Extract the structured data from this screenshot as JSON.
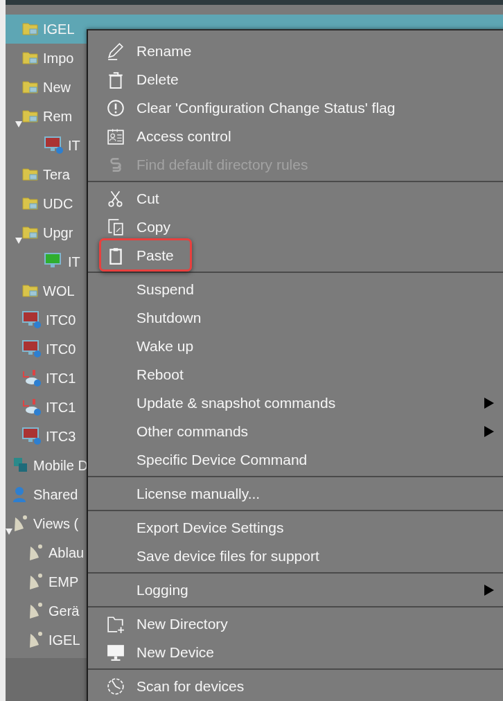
{
  "tree": {
    "device_nodes": [
      {
        "label": "IGEL",
        "kind": "folder",
        "selected": true
      },
      {
        "label": "Impo",
        "kind": "folder",
        "selected": false
      },
      {
        "label": "New",
        "kind": "folder",
        "selected": false
      },
      {
        "label": "Rem",
        "kind": "folder",
        "selected": false,
        "expanded": true,
        "children": [
          {
            "label": "IT",
            "kind": "device-offline",
            "selected": false
          }
        ]
      },
      {
        "label": "Tera",
        "kind": "folder",
        "selected": false
      },
      {
        "label": "UDC",
        "kind": "folder",
        "selected": false
      },
      {
        "label": "Upgr",
        "kind": "folder",
        "selected": false,
        "expanded": true,
        "children": [
          {
            "label": "IT",
            "kind": "device-online",
            "selected": false
          }
        ]
      },
      {
        "label": "WOL",
        "kind": "folder",
        "selected": false
      },
      {
        "label": "ITC0",
        "kind": "device-offline",
        "selected": false
      },
      {
        "label": "ITC0",
        "kind": "device-offline",
        "selected": false
      },
      {
        "label": "ITC1",
        "kind": "ud-device",
        "selected": false
      },
      {
        "label": "ITC1",
        "kind": "ud-device",
        "selected": false
      },
      {
        "label": "ITC3",
        "kind": "device-offline",
        "selected": false
      }
    ],
    "root_nodes": [
      {
        "label": "Mobile D",
        "kind": "mobile",
        "selected": false
      },
      {
        "label": "Shared",
        "kind": "user",
        "selected": false
      },
      {
        "label": "Views (",
        "kind": "view",
        "selected": false,
        "expanded": true,
        "children": [
          {
            "label": "Ablau",
            "kind": "view",
            "selected": false
          },
          {
            "label": "EMP",
            "kind": "view",
            "selected": false
          },
          {
            "label": "Gerä",
            "kind": "view",
            "selected": false
          },
          {
            "label": "IGEL",
            "kind": "view",
            "selected": false
          }
        ]
      }
    ]
  },
  "context_menu": {
    "sections": [
      {
        "items": [
          {
            "label": "Rename",
            "kind": "pencil",
            "disabled": false,
            "submenu": false,
            "highlighted": false
          },
          {
            "label": "Delete",
            "kind": "trash",
            "disabled": false,
            "submenu": false,
            "highlighted": false
          },
          {
            "label": "Clear 'Configuration Change Status' flag",
            "kind": "exclamation",
            "disabled": false,
            "submenu": false,
            "highlighted": false
          },
          {
            "label": "Access control",
            "kind": "id-card",
            "disabled": false,
            "submenu": false,
            "highlighted": false
          },
          {
            "label": "Find default directory rules",
            "kind": "section",
            "disabled": true,
            "submenu": false,
            "highlighted": false
          }
        ]
      },
      {
        "items": [
          {
            "label": "Cut",
            "kind": "scissors",
            "disabled": false,
            "submenu": false,
            "highlighted": false
          },
          {
            "label": "Copy",
            "kind": "copy",
            "disabled": false,
            "submenu": false,
            "highlighted": false
          },
          {
            "label": "Paste",
            "kind": "clipboard",
            "disabled": false,
            "submenu": false,
            "highlighted": true
          }
        ]
      },
      {
        "items": [
          {
            "label": "Suspend",
            "disabled": false,
            "submenu": false,
            "highlighted": false
          },
          {
            "label": "Shutdown",
            "disabled": false,
            "submenu": false,
            "highlighted": false
          },
          {
            "label": "Wake up",
            "disabled": false,
            "submenu": false,
            "highlighted": false
          },
          {
            "label": "Reboot",
            "disabled": false,
            "submenu": false,
            "highlighted": false
          },
          {
            "label": "Update & snapshot commands",
            "disabled": false,
            "submenu": true,
            "highlighted": false
          },
          {
            "label": "Other commands",
            "disabled": false,
            "submenu": true,
            "highlighted": false
          },
          {
            "label": "Specific Device Command",
            "disabled": false,
            "submenu": false,
            "highlighted": false
          }
        ]
      },
      {
        "items": [
          {
            "label": "License manually...",
            "disabled": false,
            "submenu": false,
            "highlighted": false
          }
        ]
      },
      {
        "items": [
          {
            "label": "Export Device Settings",
            "disabled": false,
            "submenu": false,
            "highlighted": false
          },
          {
            "label": "Save device files for support",
            "disabled": false,
            "submenu": false,
            "highlighted": false
          }
        ]
      },
      {
        "items": [
          {
            "label": "Logging",
            "disabled": false,
            "submenu": true,
            "highlighted": false
          }
        ]
      },
      {
        "items": [
          {
            "label": "New Directory",
            "kind": "folder-plus",
            "disabled": false,
            "submenu": false,
            "highlighted": false
          },
          {
            "label": "New Device",
            "kind": "monitor",
            "disabled": false,
            "submenu": false,
            "highlighted": false
          }
        ]
      },
      {
        "items": [
          {
            "label": "Scan for devices",
            "kind": "radar",
            "disabled": false,
            "submenu": false,
            "highlighted": false
          }
        ]
      }
    ]
  }
}
